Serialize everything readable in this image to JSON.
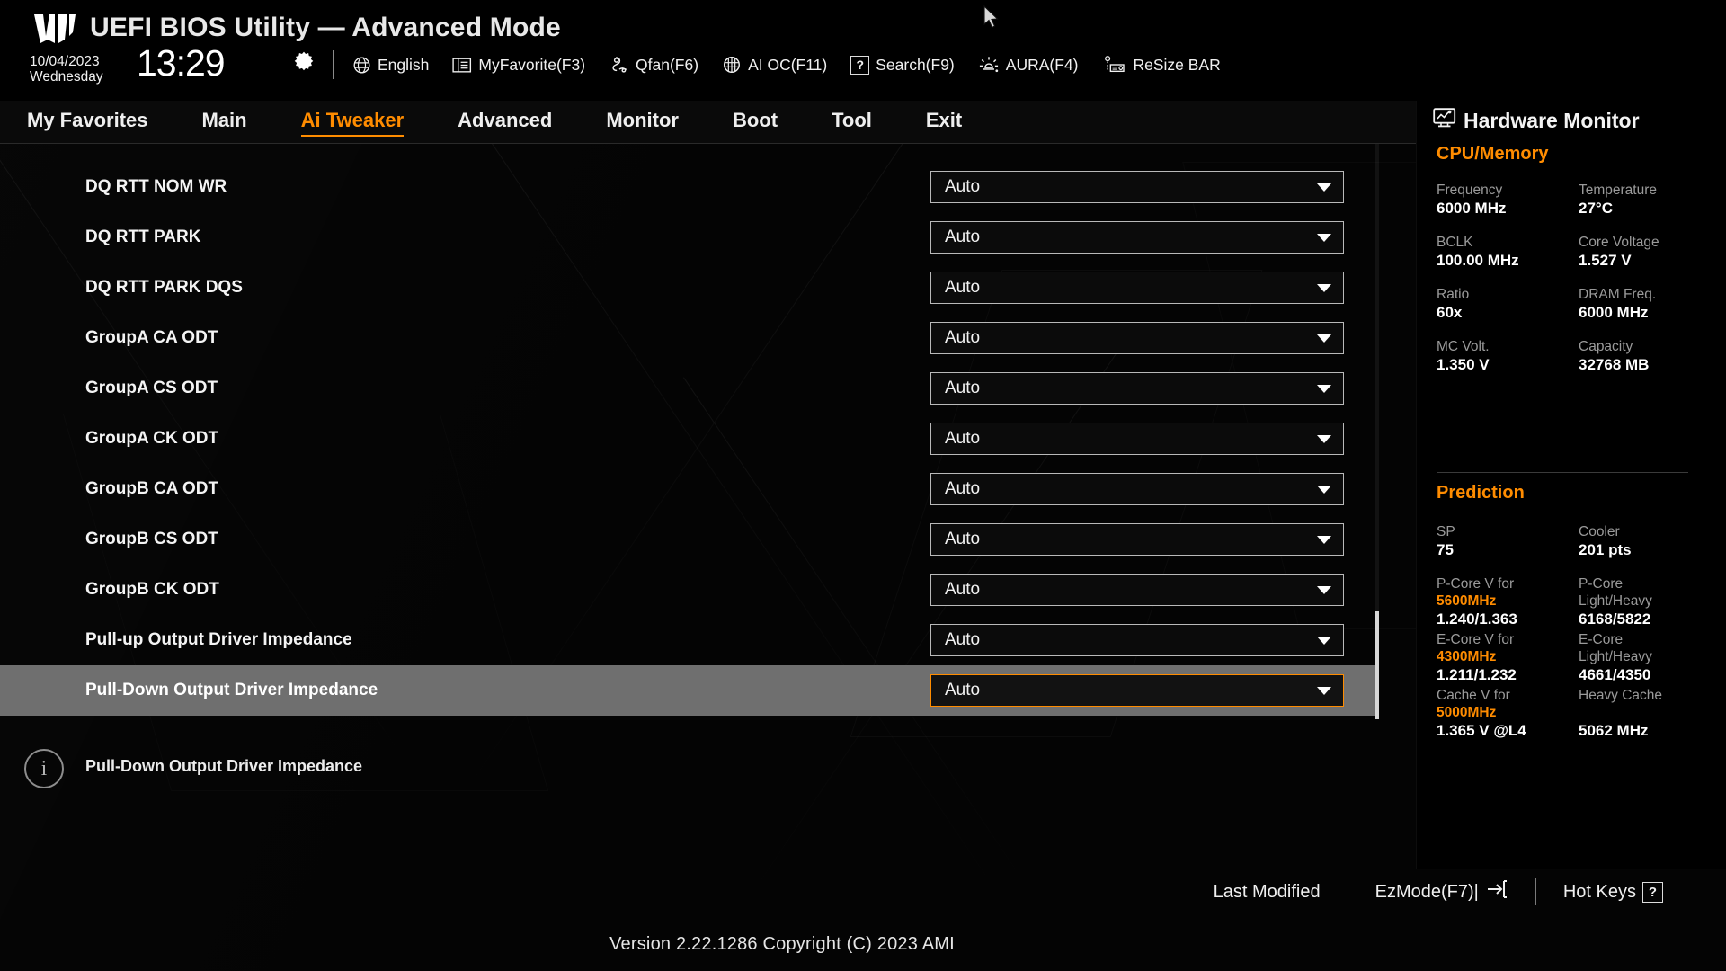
{
  "header": {
    "app_title": "UEFI BIOS Utility — Advanced Mode",
    "logo_name": "tuf-gaming-logo",
    "date": "10/04/2023",
    "weekday": "Wednesday",
    "time": "13:29",
    "accent_color": "#ff8c00",
    "toolbar": [
      {
        "icon": "globe-icon",
        "label": "English"
      },
      {
        "icon": "myfavorite-icon",
        "label": "MyFavorite(F3)"
      },
      {
        "icon": "qfan-icon",
        "label": "Qfan(F6)"
      },
      {
        "icon": "ai-oc-icon",
        "label": "AI OC(F11)"
      },
      {
        "icon": "question-box-icon",
        "label": "Search(F9)"
      },
      {
        "icon": "aura-icon",
        "label": "AURA(F4)"
      },
      {
        "icon": "resize-bar-icon",
        "label": "ReSize BAR"
      }
    ]
  },
  "nav": {
    "tabs": [
      {
        "label": "My Favorites",
        "active": false
      },
      {
        "label": "Main",
        "active": false
      },
      {
        "label": "Ai Tweaker",
        "active": true
      },
      {
        "label": "Advanced",
        "active": false
      },
      {
        "label": "Monitor",
        "active": false
      },
      {
        "label": "Boot",
        "active": false
      },
      {
        "label": "Tool",
        "active": false
      },
      {
        "label": "Exit",
        "active": false
      }
    ]
  },
  "settings": {
    "partial_top_value": "",
    "rows": [
      {
        "label": "DQ RTT NOM WR",
        "value": "Auto",
        "selected": false
      },
      {
        "label": "DQ RTT PARK",
        "value": "Auto",
        "selected": false
      },
      {
        "label": "DQ RTT PARK DQS",
        "value": "Auto",
        "selected": false
      },
      {
        "label": "GroupA CA ODT",
        "value": "Auto",
        "selected": false
      },
      {
        "label": "GroupA CS ODT",
        "value": "Auto",
        "selected": false
      },
      {
        "label": "GroupA CK ODT",
        "value": "Auto",
        "selected": false
      },
      {
        "label": "GroupB CA ODT",
        "value": "Auto",
        "selected": false
      },
      {
        "label": "GroupB CS ODT",
        "value": "Auto",
        "selected": false
      },
      {
        "label": "GroupB CK ODT",
        "value": "Auto",
        "selected": false
      },
      {
        "label": "Pull-up Output Driver Impedance",
        "value": "Auto",
        "selected": false
      },
      {
        "label": "Pull-Down Output Driver Impedance",
        "value": "Auto",
        "selected": true
      }
    ]
  },
  "help": {
    "icon": "info-icon",
    "text": "Pull-Down Output Driver Impedance"
  },
  "hardware_monitor": {
    "title": "Hardware Monitor",
    "title_icon": "monitor-graph-icon",
    "cpu_memory": {
      "section": "CPU/Memory",
      "items": [
        {
          "k1": "Frequency",
          "v1": "6000 MHz",
          "k2": "Temperature",
          "v2": "27°C"
        },
        {
          "k1": "BCLK",
          "v1": "100.00 MHz",
          "k2": "Core Voltage",
          "v2": "1.527 V"
        },
        {
          "k1": "Ratio",
          "v1": "60x",
          "k2": "DRAM Freq.",
          "v2": "6000 MHz"
        },
        {
          "k1": "MC Volt.",
          "v1": "1.350 V",
          "k2": "Capacity",
          "v2": "32768 MB"
        }
      ]
    },
    "prediction": {
      "section": "Prediction",
      "sp_label": "SP",
      "sp_value": "75",
      "cooler_label": "Cooler",
      "cooler_value": "201 pts",
      "pcore_label_a": "P-Core V for",
      "pcore_label_b": "5600MHz",
      "pcore_value": "1.240/1.363",
      "pcore_right_a": "P-Core",
      "pcore_right_b": "Light/Heavy",
      "pcore_right_value": "6168/5822",
      "ecore_label_a": "E-Core V for",
      "ecore_label_b": "4300MHz",
      "ecore_value": "1.211/1.232",
      "ecore_right_a": "E-Core",
      "ecore_right_b": "Light/Heavy",
      "ecore_right_value": "4661/4350",
      "cache_label_a": "Cache V for",
      "cache_label_b": "5000MHz",
      "cache_value": "1.365 V @L4",
      "cache_right_a": "Heavy Cache",
      "cache_right_value": "5062 MHz"
    }
  },
  "footer": {
    "last_modified": "Last Modified",
    "ezmode": "EzMode(F7)|",
    "hotkeys": "Hot Keys",
    "hotkeys_glyph": "?",
    "version": "Version 2.22.1286 Copyright (C) 2023 AMI"
  }
}
